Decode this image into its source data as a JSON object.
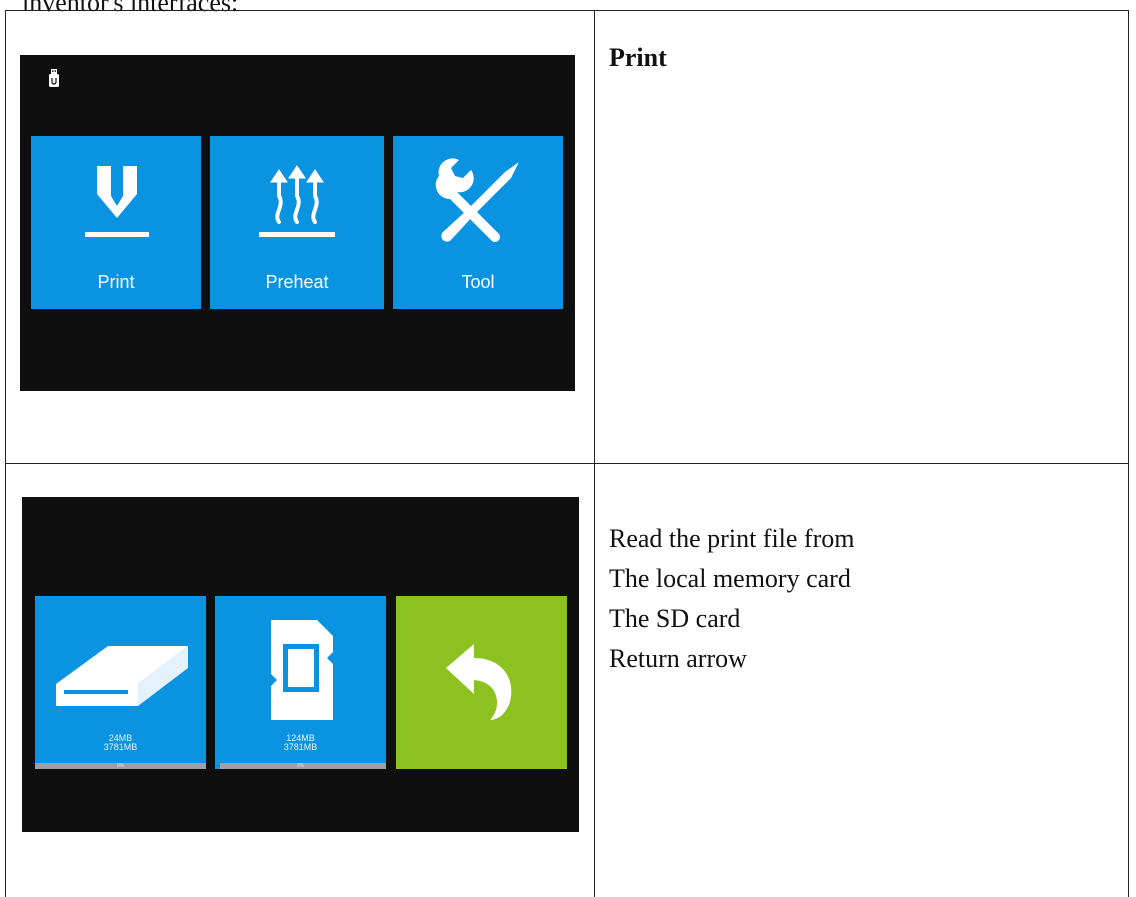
{
  "intro_text": "inventor's interfaces:",
  "row1": {
    "description": "Print",
    "screen": {
      "status_icon": "usb-drive-icon",
      "tiles": [
        {
          "label": "Print",
          "icon": "print-nozzle-icon",
          "color": "#0a93e0"
        },
        {
          "label": "Preheat",
          "icon": "preheat-heat-icon",
          "color": "#0a93e0"
        },
        {
          "label": "Tool",
          "icon": "tools-icon",
          "color": "#0a93e0"
        }
      ]
    }
  },
  "row2": {
    "description_lines": [
      "Read the print file from",
      "The local memory card",
      "The SD card",
      "Return arrow"
    ],
    "screen": {
      "tiles": [
        {
          "icon": "local-storage-icon",
          "used": "24MB",
          "total": "3781MB",
          "percent_label": "0%",
          "progress": 0.0,
          "color": "#0a93e0"
        },
        {
          "icon": "sd-card-icon",
          "used": "124MB",
          "total": "3781MB",
          "percent_label": "3%",
          "progress": 0.03,
          "color": "#0a93e0"
        },
        {
          "icon": "return-arrow-icon",
          "color": "#8cc220"
        }
      ]
    }
  }
}
